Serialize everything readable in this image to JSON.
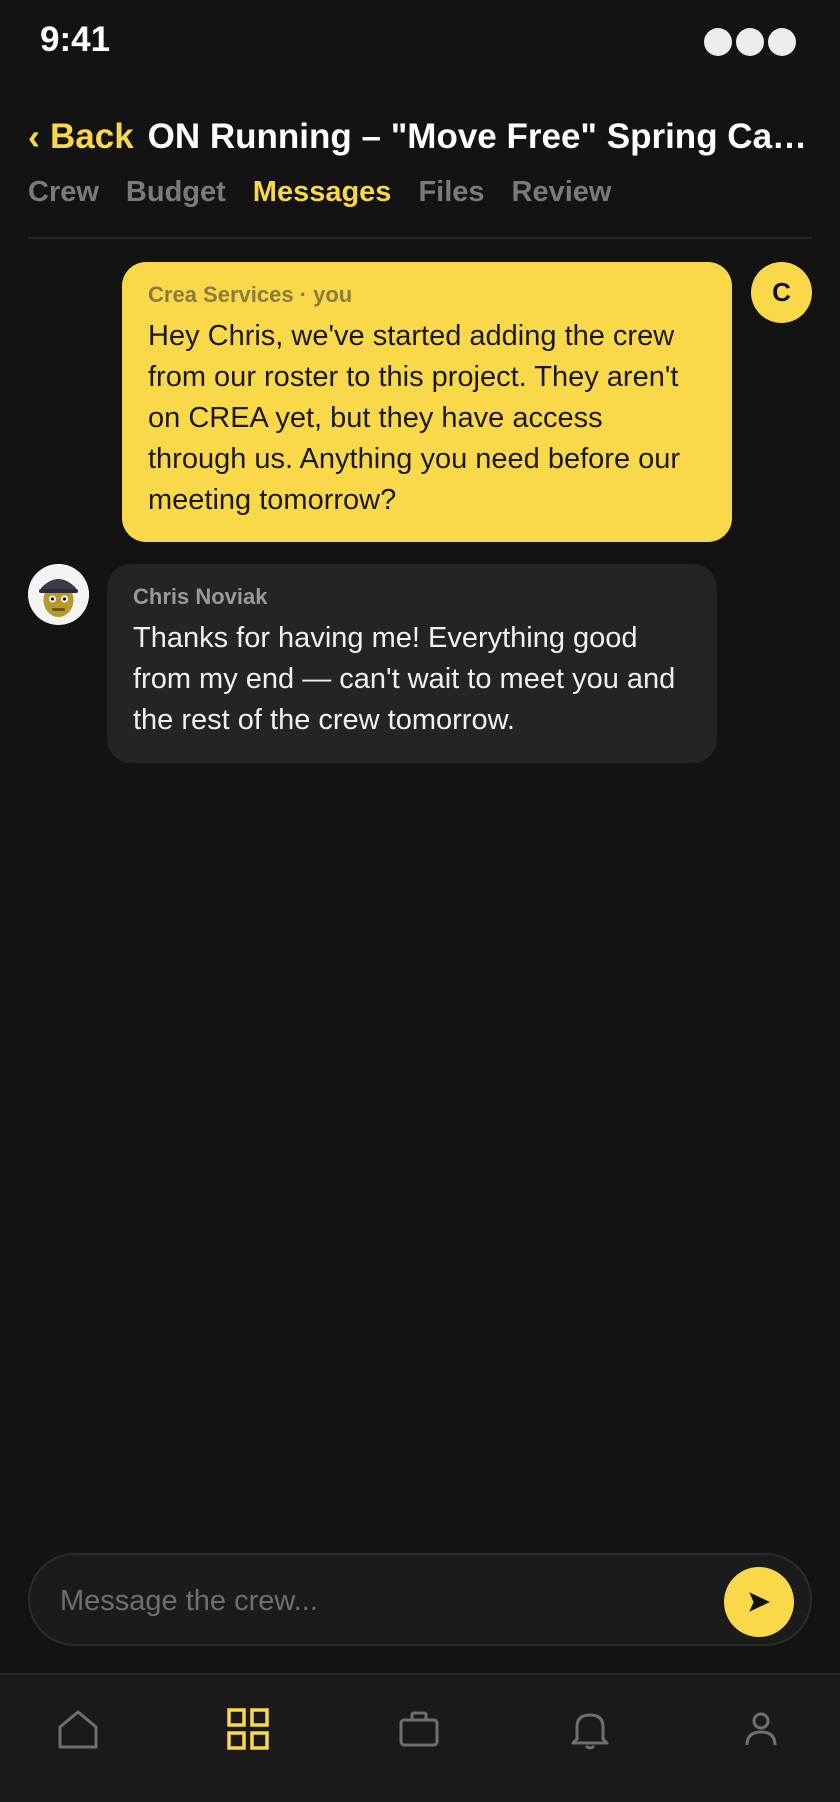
{
  "status_bar": {
    "time": "9:41"
  },
  "header": {
    "back_label": "Back",
    "back_chevron": "‹",
    "title": "ON Running – \"Move Free\" Spring Campaign"
  },
  "tabs": [
    {
      "label": "Crew",
      "active": false
    },
    {
      "label": "Budget",
      "active": false
    },
    {
      "label": "Messages",
      "active": true
    },
    {
      "label": "Files",
      "active": false
    },
    {
      "label": "Review",
      "active": false
    }
  ],
  "messages": [
    {
      "sender": "Crea Services · you",
      "text": "Hey Chris, we've started adding the crew from our roster to this project. They aren't on CREA yet, but they have access through us. Anything you need before our meeting tomorrow?",
      "avatar_initial": "C",
      "outgoing": true
    },
    {
      "sender": "Chris Noviak",
      "text": "Thanks for having me! Everything good from my end — can't wait to meet you and the rest of the crew tomorrow.",
      "avatar": "user-photo-avatar",
      "outgoing": false
    }
  ],
  "composer": {
    "placeholder": "Message the crew..."
  },
  "bottom_nav": [
    {
      "icon": "home-icon",
      "active": false
    },
    {
      "icon": "grid-icon",
      "active": true
    },
    {
      "icon": "briefcase-icon",
      "active": false
    },
    {
      "icon": "bell-icon",
      "active": false
    },
    {
      "icon": "profile-icon",
      "active": false
    }
  ],
  "colors": {
    "accent": "#f9d84a",
    "background": "#131313",
    "bubble_in": "#242424",
    "inactive": "#7a7a7a"
  }
}
